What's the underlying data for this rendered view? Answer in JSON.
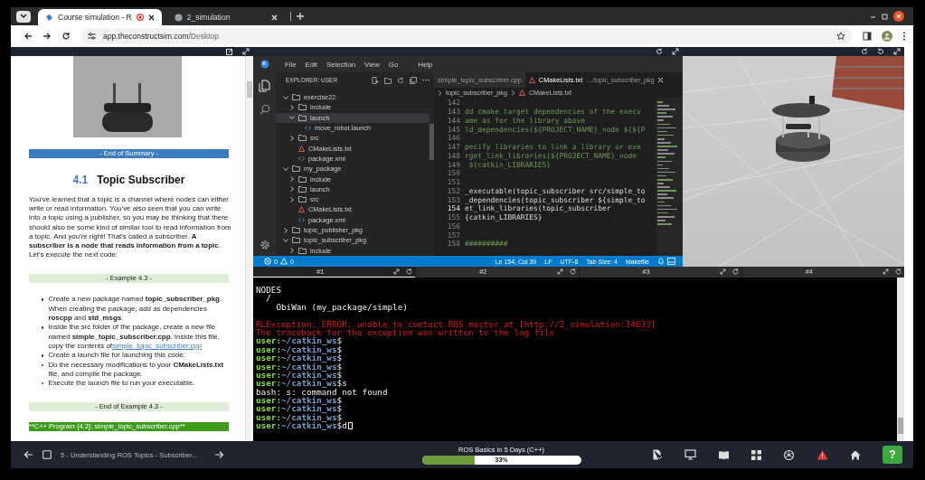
{
  "browser": {
    "tabs": [
      {
        "title": "Course simulation - R",
        "selected": true,
        "recording": true
      },
      {
        "title": "2_simulation",
        "selected": false,
        "recording": false
      }
    ],
    "url_host": "app.theconstructsim.com",
    "url_path": "/Desktop"
  },
  "notebook": {
    "blocks": [
      {
        "kind": "image"
      },
      {
        "kind": "summary-banner",
        "text": "- End of Summary -"
      },
      {
        "kind": "heading",
        "number": "4.1",
        "text": "Topic Subscriber"
      },
      {
        "kind": "paragraph",
        "text": "You've learned that a topic is a channel where nodes can either write or read information. You've also seen that you can write into a topic using a publisher, so you may be thinking that there should also be some kind of similar tool to read information from a topic. And you're right! That's called a subscriber. **A subscriber is a node that reads information from a topic**. Let's execute the next code:"
      },
      {
        "kind": "example-banner",
        "text": "- Example 4.3 -"
      },
      {
        "kind": "list",
        "items": [
          {
            "text": "Create a new package named **topic_subscriber_pkg**. When creating the package, add as dependencies **roscpp** and **std_msgs**."
          },
          {
            "text": "Inside the src folder of the package, create a new file named **simple_topic_subscriber.cpp**. Inside this file, copy the contents of",
            "link": "simple_topic_subscriber.cpp"
          },
          {
            "text": "Create a launch file for launching this code."
          },
          {
            "text": "Do the necessary modifications to your **CMakeLists.txt** file, and compile the package."
          },
          {
            "text": "Execute the launch file to run your executable."
          }
        ]
      },
      {
        "kind": "example-banner",
        "text": "- End of Example 4.3 -"
      },
      {
        "kind": "program-banner",
        "text": "**C++ Program {4.2}: simple_topic_subscriber.cpp**"
      }
    ]
  },
  "editor": {
    "menus": [
      "File",
      "Edit",
      "Selection",
      "View",
      "Go",
      "Help"
    ],
    "explorer": {
      "title": "EXPLORER: USER",
      "tree": [
        {
          "name": "exercise22",
          "kind": "folder",
          "expanded": true,
          "selected": false,
          "children": [
            {
              "name": "include",
              "kind": "folder",
              "expanded": false,
              "selected": false
            },
            {
              "name": "launch",
              "kind": "folder",
              "expanded": true,
              "selected": true,
              "children": [
                {
                  "name": "move_robot.launch",
                  "kind": "file",
                  "selected": false
                }
              ]
            },
            {
              "name": "src",
              "kind": "folder",
              "expanded": false,
              "selected": false
            },
            {
              "name": "CMakeLists.txt",
              "kind": "cmake",
              "selected": false
            },
            {
              "name": "package.xml",
              "kind": "file",
              "selected": false
            }
          ]
        },
        {
          "name": "my_package",
          "kind": "folder",
          "expanded": true,
          "selected": false,
          "children": [
            {
              "name": "include",
              "kind": "folder",
              "expanded": false,
              "selected": false
            },
            {
              "name": "launch",
              "kind": "folder",
              "expanded": false,
              "selected": false
            },
            {
              "name": "src",
              "kind": "folder",
              "expanded": false,
              "selected": false
            },
            {
              "name": "CMakeLists.txt",
              "kind": "cmake",
              "selected": false
            },
            {
              "name": "package.xml",
              "kind": "file",
              "selected": false
            }
          ]
        },
        {
          "name": "topic_publisher_pkg",
          "kind": "folder",
          "expanded": false,
          "selected": false
        },
        {
          "name": "topic_subscriber_pkg",
          "kind": "folder",
          "expanded": true,
          "selected": false,
          "children": [
            {
              "name": "include",
              "kind": "folder",
              "expanded": false,
              "selected": false
            }
          ]
        }
      ]
    },
    "tabs": [
      {
        "title": "simple_topic_subscriber.cpp",
        "kind": "file",
        "selected": false
      },
      {
        "title": "CMakeLists.txt",
        "path": "…/topic_subscriber_pkg",
        "kind": "cmake",
        "selected": true
      }
    ],
    "breadcrumb": [
      "topic_subscriber_pkg",
      "CMakeLists.txt"
    ],
    "lines": [
      {
        "number": "142",
        "current": false
      },
      {
        "number": "143",
        "kind": "comment",
        "text": "dd cmake target dependencies of the execu",
        "current": false
      },
      {
        "number": "144",
        "kind": "comment",
        "text": "ame as for the library above",
        "current": false
      },
      {
        "number": "145",
        "kind": "comment",
        "text": "ld_dependencies(${PROJECT_NAME}_node ${${P",
        "current": false
      },
      {
        "number": "146",
        "current": false
      },
      {
        "number": "147",
        "kind": "comment",
        "text": "pecify libraries to link a library or exe",
        "current": false
      },
      {
        "number": "148",
        "kind": "comment",
        "text": "rget_link_libraries(${PROJECT_NAME}_node",
        "current": false
      },
      {
        "number": "149",
        "kind": "comment",
        "text": " ${catkin_LIBRARIES}",
        "current": false
      },
      {
        "number": "150",
        "current": false
      },
      {
        "number": "151",
        "current": false
      },
      {
        "number": "152",
        "kind": "code",
        "text": "_executable(topic_subscriber src/simple_to",
        "current": false
      },
      {
        "number": "153",
        "kind": "code",
        "text": "_dependencies(topic_subscriber ${simple_to",
        "current": false
      },
      {
        "number": "154",
        "kind": "code",
        "text": "et_link_libraries(topic_subscriber",
        "current": true
      },
      {
        "number": "155",
        "kind": "code",
        "text": "{catkin_LIBRARIES}",
        "current": false
      },
      {
        "number": "156",
        "current": false
      },
      {
        "number": "157",
        "current": false
      },
      {
        "number": "158",
        "kind": "comment",
        "text": "##########",
        "current": false
      }
    ],
    "status": {
      "errors": "0",
      "warnings": "0",
      "items": [
        "Ln 154, Col 39",
        "LF",
        "UTF-8",
        "Tab Size: 4",
        "Makefile"
      ]
    }
  },
  "terminal": {
    "tabs": [
      {
        "label": "#1",
        "selected": true
      },
      {
        "label": "#2",
        "selected": false
      },
      {
        "label": "#3",
        "selected": false
      },
      {
        "label": "#4",
        "selected": false
      }
    ],
    "blocks": [
      [
        {
          "kind": "output",
          "text": "NODES"
        },
        {
          "kind": "output",
          "text": "  /"
        },
        {
          "kind": "output",
          "text": "    ObiWan (my_package/simple)"
        }
      ],
      [
        {
          "kind": "error",
          "text": "RLException: ERROR: unable to contact ROS master at [http://2_simulation:34633]"
        },
        {
          "kind": "error",
          "text": "The traceback for the exception was written to the log file"
        },
        {
          "kind": "prompt",
          "user": "user:",
          "path": "~/catkin_ws",
          "sign": "$",
          "cursor": false
        },
        {
          "kind": "prompt",
          "user": "user:",
          "path": "~/catkin_ws",
          "sign": "$",
          "cursor": false
        },
        {
          "kind": "prompt",
          "user": "user:",
          "path": "~/catkin_ws",
          "sign": "$",
          "cursor": false
        },
        {
          "kind": "prompt",
          "user": "user:",
          "path": "~/catkin_ws",
          "sign": "$",
          "cursor": false
        },
        {
          "kind": "prompt",
          "user": "user:",
          "path": "~/catkin_ws",
          "sign": "$",
          "cursor": false
        },
        {
          "kind": "prompt",
          "user": "user:",
          "path": "~/catkin_ws",
          "sign": "$",
          "command": "s",
          "cursor": false
        },
        {
          "kind": "output",
          "text": "bash: s: command not found"
        },
        {
          "kind": "prompt",
          "user": "user:",
          "path": "~/catkin_ws",
          "sign": "$",
          "cursor": false
        },
        {
          "kind": "prompt",
          "user": "user:",
          "path": "~/catkin_ws",
          "sign": "$",
          "cursor": false
        },
        {
          "kind": "prompt",
          "user": "user:",
          "path": "~/catkin_ws",
          "sign": "$",
          "cursor": false
        },
        {
          "kind": "prompt",
          "user": "user:",
          "path": "~/catkin_ws",
          "sign": "$",
          "command": "d",
          "cursor": true
        }
      ]
    ]
  },
  "bottom_bar": {
    "unit_title": "5 - Understanding ROS Topics - Subscriber...",
    "course": "ROS Basics in 5 Days (C++)",
    "progress": {
      "level": 0.33,
      "reading": "33%"
    },
    "help": "?"
  }
}
